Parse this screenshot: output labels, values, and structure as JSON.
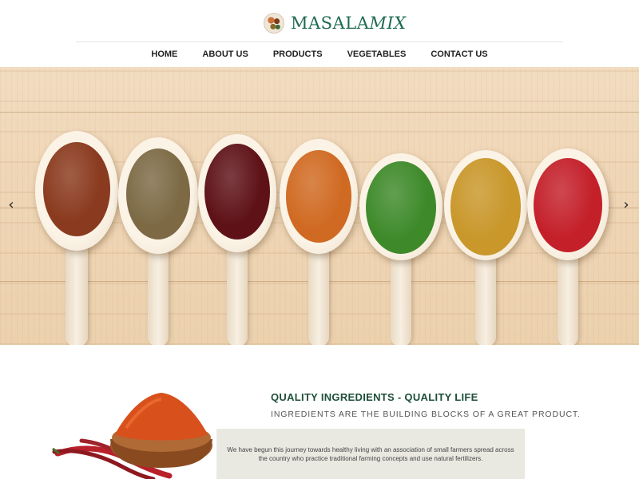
{
  "brand": {
    "name_part1": "MASALA",
    "name_part2": "MIX"
  },
  "nav": {
    "items": [
      {
        "label": "HOME"
      },
      {
        "label": "ABOUT US"
      },
      {
        "label": "PRODUCTS"
      },
      {
        "label": "VEGETABLES"
      },
      {
        "label": "CONTACT US"
      }
    ]
  },
  "hero": {
    "prev_icon": "chevron-left-icon",
    "next_icon": "chevron-right-icon",
    "prev_glyph": "‹",
    "next_glyph": "›",
    "spices": [
      {
        "color": "#8a3a1e"
      },
      {
        "color": "#7d6a45"
      },
      {
        "color": "#5e1218"
      },
      {
        "color": "#d06a22"
      },
      {
        "color": "#3e8a2a"
      },
      {
        "color": "#c9972a"
      },
      {
        "color": "#c4202a"
      }
    ]
  },
  "about": {
    "heading": "QUALITY INGREDIENTS - QUALITY LIFE",
    "subheading": "INGREDIENTS ARE THE BUILDING BLOCKS OF A GREAT PRODUCT.",
    "body": "We have begun this journey towards healthy living with an association of small farmers spread across the country who practice traditional farming concepts and use natural fertilizers."
  },
  "colors": {
    "brand_green": "#1f6b4f",
    "heading_green": "#1f4f3a",
    "textbox_bg": "#e9e9e2"
  }
}
